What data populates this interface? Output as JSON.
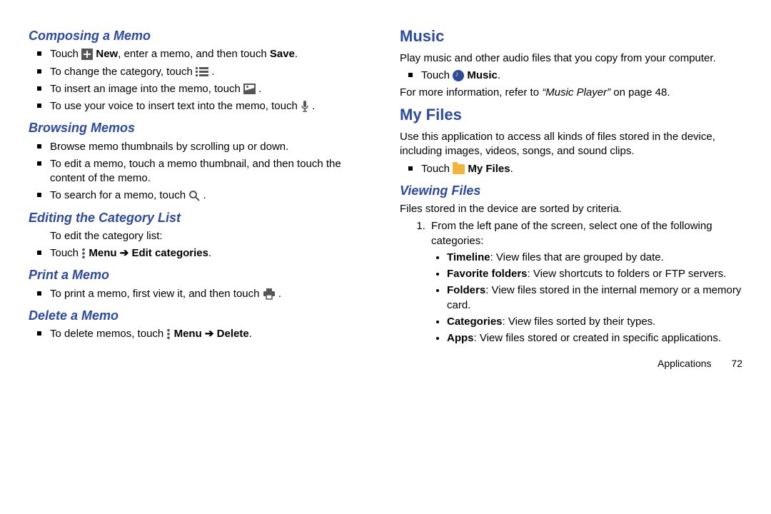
{
  "left": {
    "composing": {
      "heading": "Composing a Memo",
      "items": {
        "i0a": "Touch ",
        "i0b_bold": "New",
        "i0c": ", enter a memo, and then touch ",
        "i0d_bold": "Save",
        "i0e": ".",
        "i1a": "To change the category, touch ",
        "i1b": ".",
        "i2a": "To insert an image into the memo, touch ",
        "i2b": ".",
        "i3a": "To use your voice to insert text into the memo, touch ",
        "i3b": "."
      }
    },
    "browsing": {
      "heading": "Browsing Memos",
      "items": {
        "i0": "Browse memo thumbnails by scrolling up or down.",
        "i1": "To edit a memo, touch a memo thumbnail, and then touch the content of the memo.",
        "i2a": "To search for a memo, touch ",
        "i2b": "."
      }
    },
    "editcat": {
      "heading": "Editing the Category List",
      "intro": "To edit the category list:",
      "item_a": "Touch ",
      "item_menu": "Menu",
      "arrow": " ➔ ",
      "item_edit": "Edit categories",
      "item_end": "."
    },
    "print": {
      "heading": "Print a Memo",
      "item_a": "To print a memo, first view it, and then touch ",
      "item_b": "."
    },
    "delete": {
      "heading": "Delete a Memo",
      "item_a": "To delete memos, touch ",
      "item_menu": "Menu",
      "arrow": " ➔ ",
      "item_del": "Delete",
      "item_end": "."
    }
  },
  "right": {
    "music": {
      "heading": "Music",
      "p1": "Play music and other audio files that you copy from your computer.",
      "li_a": "Touch ",
      "li_b_bold": "Music",
      "li_c": ".",
      "p2a": "For more information, refer to ",
      "p2b_ital": "“Music Player”",
      "p2c": " on page 48."
    },
    "myfiles": {
      "heading": "My Files",
      "p1": "Use this application to access all kinds of files stored in the device, including images, videos, songs, and sound clips.",
      "li_a": "Touch ",
      "li_b_bold": "My Files",
      "li_c": "."
    },
    "viewing": {
      "heading": "Viewing Files",
      "p1": "Files stored in the device are sorted by criteria.",
      "ol1": "From the left pane of the screen, select one of the following categories:",
      "cats": {
        "c0b": "Timeline",
        "c0t": ": View files that are grouped by date.",
        "c1b": "Favorite folders",
        "c1t": ": View shortcuts to folders or FTP servers.",
        "c2b": "Folders",
        "c2t": ": View files stored in the internal memory or a memory card.",
        "c3b": "Categories",
        "c3t": ": View files sorted by their types.",
        "c4b": "Apps",
        "c4t": ": View files stored or created in specific applications."
      }
    }
  },
  "footer": {
    "section": "Applications",
    "page": "72"
  }
}
